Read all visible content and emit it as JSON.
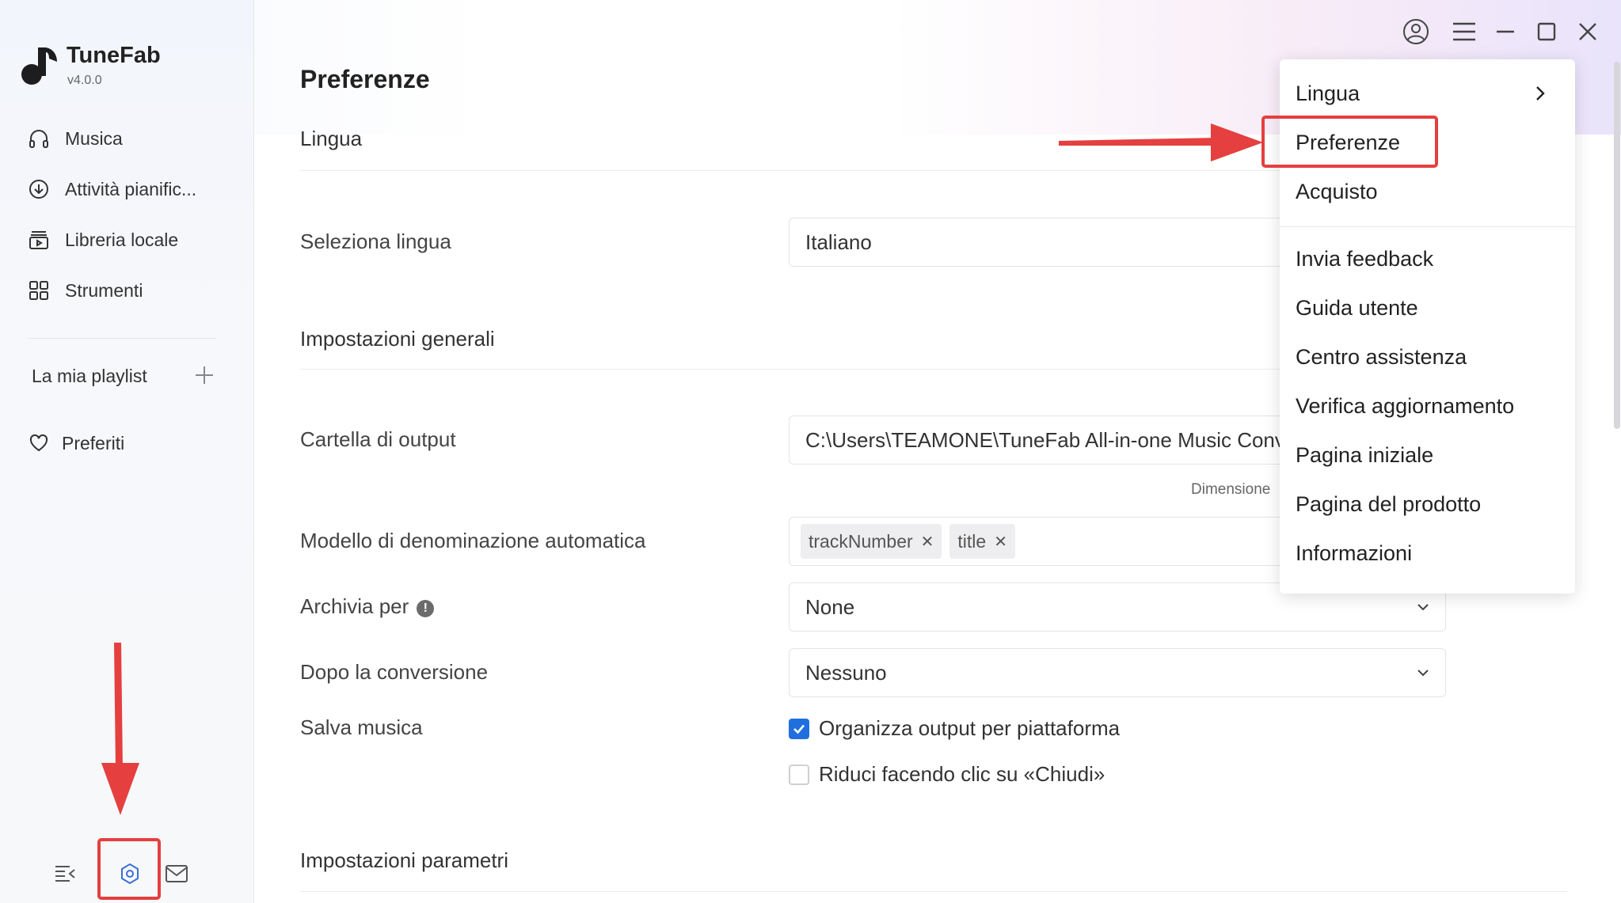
{
  "app": {
    "name": "TuneFab",
    "version": "v4.0.0"
  },
  "sidebar": {
    "items": [
      {
        "label": "Musica",
        "icon": "headphones-icon"
      },
      {
        "label": "Attività pianific...",
        "icon": "download-circle-icon"
      },
      {
        "label": "Libreria locale",
        "icon": "library-icon"
      },
      {
        "label": "Strumenti",
        "icon": "grid-icon"
      }
    ],
    "playlist_label": "La mia playlist",
    "favorites_label": "Preferiti",
    "bottom_icons": [
      "collapse-sidebar-icon",
      "settings-icon",
      "mail-icon"
    ]
  },
  "titlebar_icons": [
    "account-icon",
    "hamburger-menu-icon",
    "minimize-icon",
    "maximize-icon",
    "close-icon"
  ],
  "main": {
    "title": "Preferenze",
    "sections": {
      "language": "Lingua",
      "general": "Impostazioni generali",
      "parameters": "Impostazioni parametri"
    },
    "rows": {
      "select_language": {
        "label": "Seleziona lingua",
        "value": "Italiano"
      },
      "output_folder": {
        "label": "Cartella di output",
        "value": "C:\\Users\\TEAMONE\\TuneFab All-in-one Music Converter",
        "hint": "Dimensione"
      },
      "naming_template": {
        "label": "Modello di denominazione automatica",
        "tags": [
          "trackNumber",
          "title"
        ]
      },
      "archive_by": {
        "label": "Archivia per",
        "info": "!",
        "value": "None"
      },
      "after_conversion": {
        "label": "Dopo la conversione",
        "value": "Nessuno"
      },
      "save_music": {
        "label": "Salva musica",
        "options": [
          {
            "label": "Organizza output per piattaforma",
            "checked": true
          },
          {
            "label": "Riduci facendo clic su «Chiudi»",
            "checked": false
          }
        ]
      }
    }
  },
  "menu": {
    "items": [
      "Lingua",
      "Preferenze",
      "Acquisto",
      "Invia feedback",
      "Guida utente",
      "Centro assistenza",
      "Verifica aggiornamento",
      "Pagina iniziale",
      "Pagina del prodotto",
      "Informazioni"
    ]
  },
  "colors": {
    "accent": "#1f6fde",
    "annotation": "#e53f3f"
  }
}
